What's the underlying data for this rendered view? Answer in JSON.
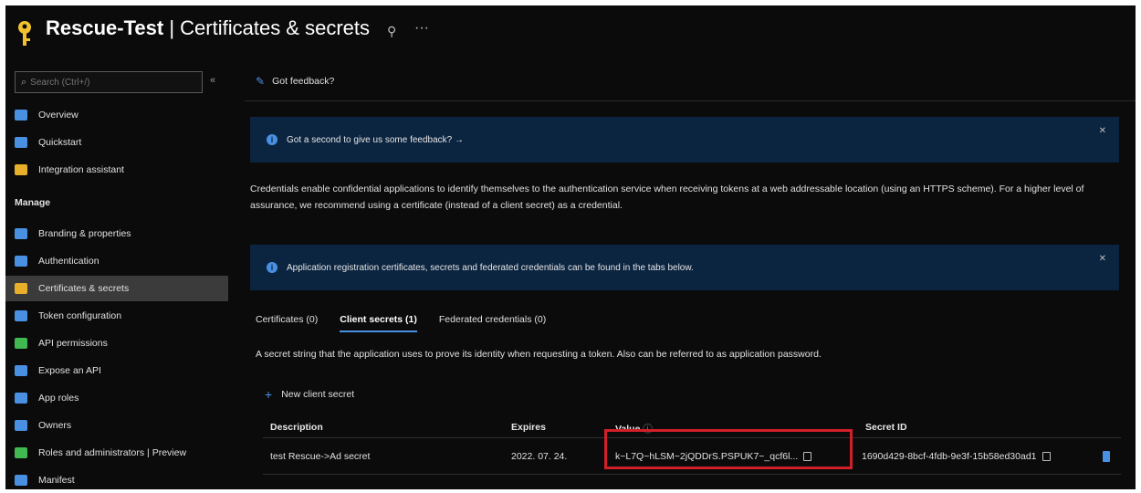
{
  "header": {
    "app_name": "Rescue-Test",
    "separator": " | ",
    "page_title": "Certificates & secrets",
    "pin_glyph": "⚲",
    "more_glyph": "···"
  },
  "sidebar": {
    "search_placeholder": "Search (Ctrl+/)",
    "collapse_glyph": "«",
    "items_top": [
      {
        "label": "Overview",
        "icon": "overview-icon",
        "color": "#4a90e2"
      },
      {
        "label": "Quickstart",
        "icon": "quickstart-icon",
        "color": "#4a90e2"
      },
      {
        "label": "Integration assistant",
        "icon": "rocket-icon",
        "color": "#e8b02a"
      }
    ],
    "manage_label": "Manage",
    "items_manage": [
      {
        "label": "Branding & properties",
        "icon": "branding-icon",
        "color": "#4a90e2"
      },
      {
        "label": "Authentication",
        "icon": "authentication-icon",
        "color": "#4a90e2"
      },
      {
        "label": "Certificates & secrets",
        "icon": "key-icon",
        "color": "#e8b02a",
        "active": true
      },
      {
        "label": "Token configuration",
        "icon": "token-icon",
        "color": "#4a90e2"
      },
      {
        "label": "API permissions",
        "icon": "api-permissions-icon",
        "color": "#3fb950"
      },
      {
        "label": "Expose an API",
        "icon": "cloud-icon",
        "color": "#4a90e2"
      },
      {
        "label": "App roles",
        "icon": "app-roles-icon",
        "color": "#4a90e2"
      },
      {
        "label": "Owners",
        "icon": "owners-icon",
        "color": "#4a90e2"
      },
      {
        "label": "Roles and administrators | Preview",
        "icon": "roles-icon",
        "color": "#3fb950"
      },
      {
        "label": "Manifest",
        "icon": "manifest-icon",
        "color": "#4a90e2"
      }
    ]
  },
  "main": {
    "feedback_label": "Got feedback?",
    "banner1": "Got a second to give us some feedback? →",
    "banner2": "Application registration certificates, secrets and federated credentials can be found in the tabs below.",
    "banner_close": "✕",
    "description": "Credentials enable confidential applications to identify themselves to the authentication service when receiving tokens at a web addressable location (using an HTTPS scheme). For a higher level of assurance, we recommend using a certificate (instead of a client secret) as a credential.",
    "tabs": [
      {
        "label": "Certificates (0)",
        "active": false
      },
      {
        "label": "Client secrets (1)",
        "active": true
      },
      {
        "label": "Federated credentials (0)",
        "active": false
      }
    ],
    "secret_description": "A secret string that the application uses to prove its identity when requesting a token. Also can be referred to as application password.",
    "new_secret_label": "New client secret",
    "table": {
      "headers": [
        "Description",
        "Expires",
        "Value",
        "Secret ID"
      ],
      "rows": [
        {
          "description": "test Rescue->Ad secret",
          "expires": "2022. 07. 24.",
          "value": "k~L7Q~hLSM~2jQDDrS.PSPUK7~_qcf6l...",
          "secret_id": "1690d429-8bcf-4fdb-9e3f-15b58ed30ad1"
        }
      ]
    }
  }
}
